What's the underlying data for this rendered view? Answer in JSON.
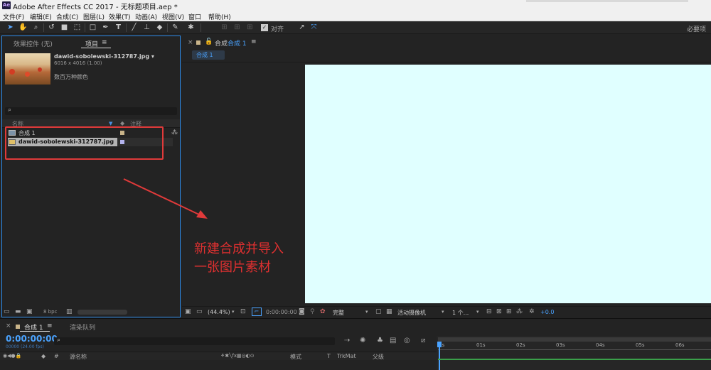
{
  "window": {
    "logo": "Ae",
    "title": "Adobe After Effects CC 2017 - 无标题项目.aep *"
  },
  "menu": [
    "文件(F)",
    "编辑(E)",
    "合成(C)",
    "图层(L)",
    "效果(T)",
    "动画(A)",
    "视图(V)",
    "窗口",
    "帮助(H)"
  ],
  "toolbar": {
    "align_label": "对齐",
    "workspace_label": "必要项"
  },
  "left_panel": {
    "tab_effects": "效果控件 (无)",
    "tab_project": "项目",
    "menu_glyph": "≡",
    "asset_name": "dawid-sobolewski-312787.jpg ▾",
    "asset_dims": "6016 x 4016 (1.00)",
    "asset_colors": "数百万种颜色",
    "search_glyph": "⌕",
    "col_name": "名称",
    "col_comment": "注释",
    "items": [
      {
        "name": "合成 1",
        "type": "comp"
      },
      {
        "name": "dawid-sobolewski-312787.jpg",
        "type": "footage"
      }
    ],
    "bpc": "8 bpc"
  },
  "viewer": {
    "tab_comp": "合成",
    "comp_name": "合成 1",
    "comp_tab_label": "合成 1",
    "menu_glyph": "≡",
    "canvas_color": "#e0ffff",
    "zoom": "(44.4%)",
    "timecode": "0:00:00:00",
    "quality": "完整",
    "camera": "活动摄像机",
    "views": "1 个...",
    "exposure": "+0.0"
  },
  "annotation": {
    "line1": "新建合成并导入",
    "line2": "一张图片素材",
    "color": "#e03030"
  },
  "timeline": {
    "comp_tab": "合成 1",
    "render_tab": "渲染队列",
    "timecode": "0:00:00:00",
    "fps": "00000 (24.00 fps)",
    "col_hash": "#",
    "col_source": "源名称",
    "col_mode": "模式",
    "col_t": "T",
    "col_trkmat": "TrkMat",
    "col_parent": "父级",
    "ruler": [
      "0s",
      "01s",
      "02s",
      "03s",
      "04s",
      "05s",
      "06s"
    ]
  }
}
